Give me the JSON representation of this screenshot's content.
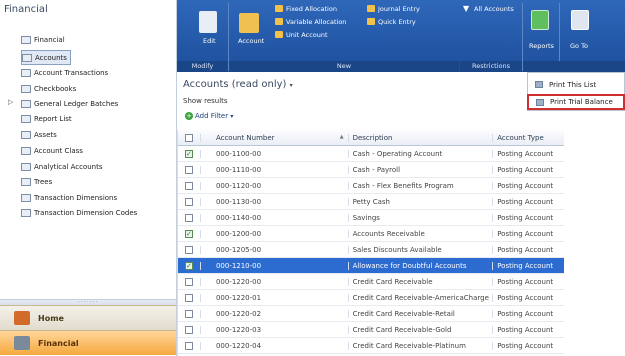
{
  "nav": {
    "title": "Financial",
    "items": [
      {
        "label": "Financial"
      },
      {
        "label": "Accounts"
      },
      {
        "label": "Account Transactions"
      },
      {
        "label": "Checkbooks"
      },
      {
        "label": "General Ledger Batches"
      },
      {
        "label": "Report List"
      },
      {
        "label": "Assets"
      },
      {
        "label": "Account Class"
      },
      {
        "label": "Analytical Accounts"
      },
      {
        "label": "Trees"
      },
      {
        "label": "Transaction Dimensions"
      },
      {
        "label": "Transaction Dimension Codes"
      }
    ],
    "home_label": "Home",
    "financial_label": "Financial"
  },
  "ribbon": {
    "edit": "Edit",
    "account": "Account",
    "fixed_allocation": "Fixed Allocation",
    "variable_allocation": "Variable Allocation",
    "unit_account": "Unit Account",
    "journal_entry": "Journal Entry",
    "quick_entry": "Quick Entry",
    "all_accounts": "All Accounts",
    "reports": "Reports",
    "go_to": "Go To",
    "groups": {
      "modify": "Modify",
      "new": "New",
      "restrictions": "Restrictions"
    }
  },
  "view": {
    "title": "Accounts (read only)",
    "show_results": "Show results",
    "add_filter": "Add Filter"
  },
  "grid": {
    "columns": [
      "Account Number",
      "Description",
      "Account Type"
    ],
    "rows": [
      {
        "num": "000-1100-00",
        "desc": "Cash - Operating Account",
        "type": "Posting Account",
        "checked": true
      },
      {
        "num": "000-1110-00",
        "desc": "Cash - Payroll",
        "type": "Posting Account",
        "checked": false
      },
      {
        "num": "000-1120-00",
        "desc": "Cash - Flex Benefits Program",
        "type": "Posting Account",
        "checked": false
      },
      {
        "num": "000-1130-00",
        "desc": "Petty Cash",
        "type": "Posting Account",
        "checked": false
      },
      {
        "num": "000-1140-00",
        "desc": "Savings",
        "type": "Posting Account",
        "checked": false
      },
      {
        "num": "000-1200-00",
        "desc": "Accounts Receivable",
        "type": "Posting Account",
        "checked": true
      },
      {
        "num": "000-1205-00",
        "desc": "Sales Discounts Available",
        "type": "Posting Account",
        "checked": false
      },
      {
        "num": "000-1210-00",
        "desc": "Allowance for Doubtful Accounts",
        "type": "Posting Account",
        "checked": true,
        "selected": true
      },
      {
        "num": "000-1220-00",
        "desc": "Credit Card Receivable",
        "type": "Posting Account",
        "checked": false
      },
      {
        "num": "000-1220-01",
        "desc": "Credit Card Receivable-AmericaCharge",
        "type": "Posting Account",
        "checked": false
      },
      {
        "num": "000-1220-02",
        "desc": "Credit Card Receivable-Retail",
        "type": "Posting Account",
        "checked": false
      },
      {
        "num": "000-1220-03",
        "desc": "Credit Card Receivable-Gold",
        "type": "Posting Account",
        "checked": false
      },
      {
        "num": "000-1220-04",
        "desc": "Credit Card Receivable-Platinum",
        "type": "Posting Account",
        "checked": false
      }
    ]
  },
  "dropdown": {
    "items": [
      "Print This List",
      "Print Trial Balance"
    ]
  }
}
